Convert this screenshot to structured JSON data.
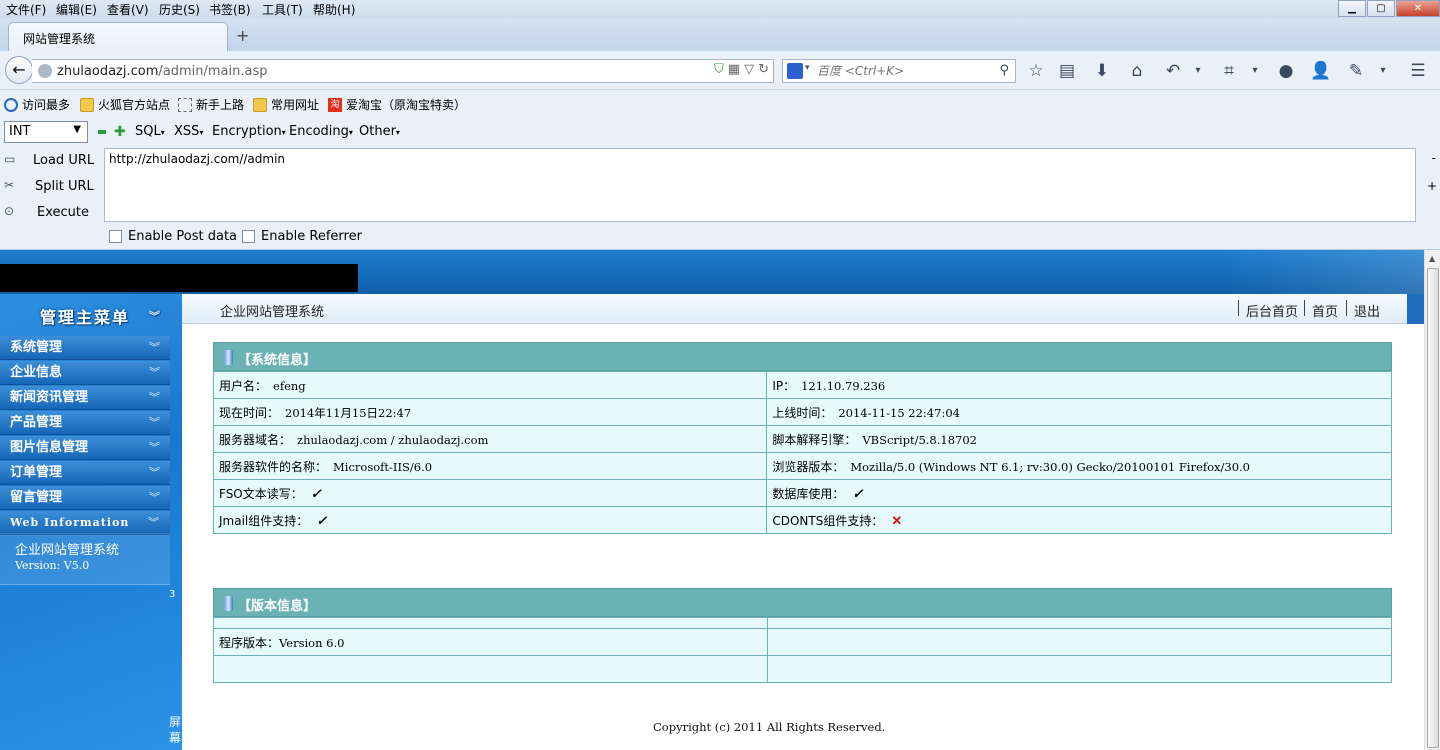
{
  "menubar": {
    "items": [
      "文件(F)",
      "编辑(E)",
      "查看(V)",
      "历史(S)",
      "书签(B)",
      "工具(T)",
      "帮助(H)"
    ]
  },
  "tabs": {
    "active_title": "网站管理系统",
    "new_tab": "+"
  },
  "nav": {
    "url_host": "zhulaodazj.com",
    "url_path": "/admin/main.asp",
    "search_engine": "百度",
    "search_placeholder": "百度 <Ctrl+K>"
  },
  "bookmarks": [
    "访问最多",
    "火狐官方站点",
    "新手上路",
    "常用网址",
    "爱淘宝（原淘宝特卖）"
  ],
  "hackbar": {
    "select_value": "INT",
    "menus": [
      "SQL",
      "XSS",
      "Encryption",
      "Encoding",
      "Other"
    ],
    "load_url": "Load URL",
    "split_url": "Split URL",
    "execute": "Execute",
    "url_value": "http://zhulaodazj.com//admin",
    "minus": "-",
    "plus": "+",
    "enable_post": "Enable Post data",
    "enable_referrer": "Enable Referrer"
  },
  "sidebar": {
    "title": "管理主菜单",
    "items": [
      "系统管理",
      "企业信息",
      "新闻资讯管理",
      "产品管理",
      "图片信息管理",
      "订单管理",
      "留言管理",
      "Web Information"
    ],
    "info_name": "企业网站管理系统",
    "info_version": "Version: V5.0",
    "side_number": "3",
    "screen_label": "屏幕"
  },
  "header": {
    "title": "企业网站管理系统",
    "links": [
      "后台首页",
      "首页",
      "退出"
    ]
  },
  "system_info": {
    "title": "【系统信息】",
    "rows": [
      [
        {
          "k": "用户名：",
          "v": "efeng"
        },
        {
          "k": "IP：",
          "v": "121.10.79.236"
        }
      ],
      [
        {
          "k": "现在时间：",
          "v": "2014年11月15日22:47"
        },
        {
          "k": "上线时间：",
          "v": "2014-11-15 22:47:04"
        }
      ],
      [
        {
          "k": "服务器域名：",
          "v": "zhulaodazj.com / zhulaodazj.com"
        },
        {
          "k": "脚本解释引擎：",
          "v": "VBScript/5.8.18702"
        }
      ],
      [
        {
          "k": "服务器软件的名称：",
          "v": "Microsoft-IIS/6.0"
        },
        {
          "k": "浏览器版本：",
          "v": "Mozilla/5.0 (Windows NT 6.1; rv:30.0) Gecko/20100101 Firefox/30.0"
        }
      ],
      [
        {
          "k": "FSO文本读写：",
          "v": "✓"
        },
        {
          "k": "数据库使用：",
          "v": "✓"
        }
      ],
      [
        {
          "k": "Jmail组件支持：",
          "v": "✓"
        },
        {
          "k": "CDONTS组件支持：",
          "v": "✕"
        }
      ]
    ]
  },
  "version_info": {
    "title": "【版本信息】",
    "program_version_label": "程序版本：",
    "program_version": "Version 6.0"
  },
  "footer": {
    "copyright": "Copyright (c) 2011 All Rights Reserved."
  },
  "colors": {
    "panel_head": "#6bb2b4",
    "table_bg": "#e7fbfd",
    "sidebar": "#1878cf"
  }
}
